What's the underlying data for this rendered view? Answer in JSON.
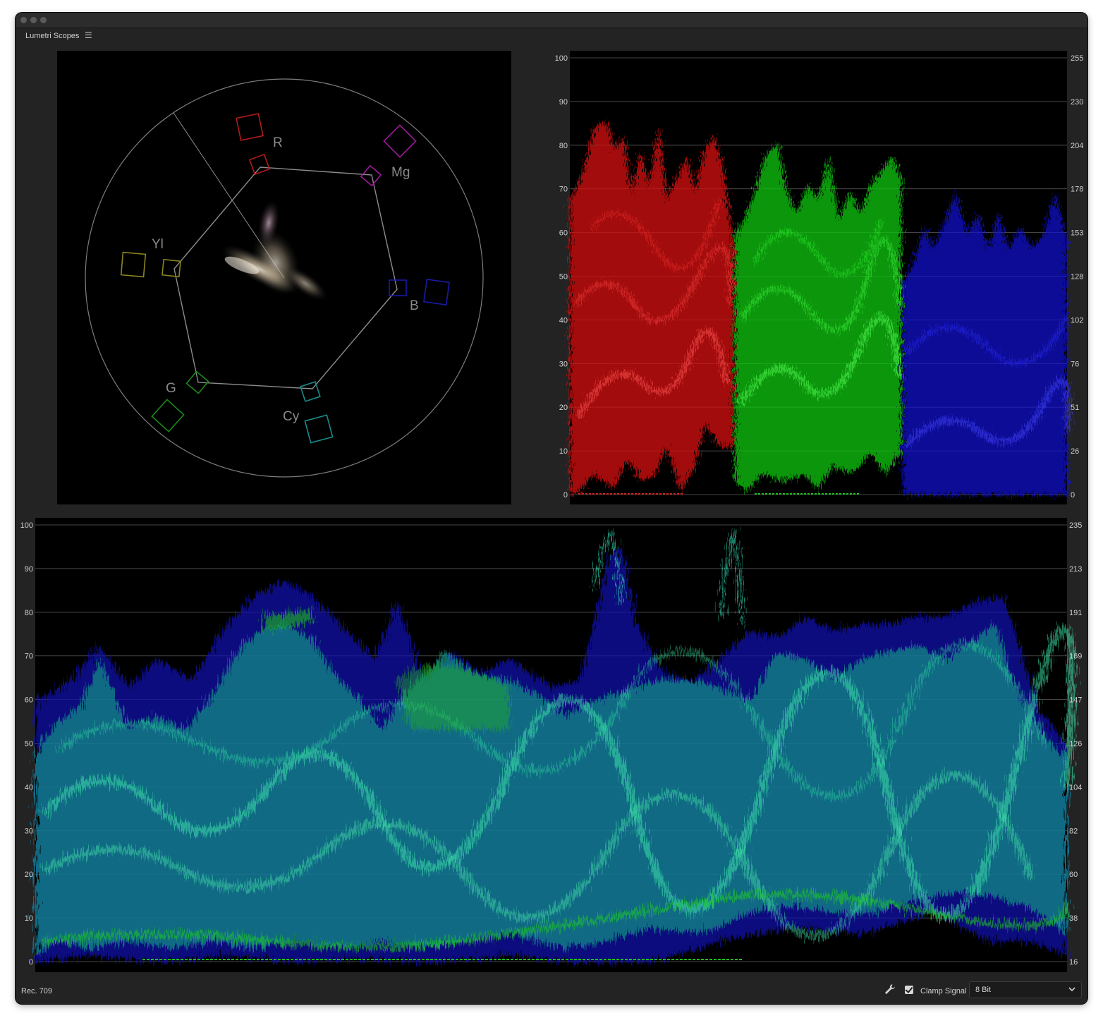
{
  "panel": {
    "title": "Lumetri Scopes",
    "menu_icon": "hamburger-menu-icon"
  },
  "vectorscope": {
    "targets": [
      "R",
      "Mg",
      "B",
      "Cy",
      "G",
      "Yl"
    ]
  },
  "parade": {
    "left_ticks": [
      "100",
      "90",
      "80",
      "70",
      "60",
      "50",
      "40",
      "30",
      "20",
      "10",
      "0"
    ],
    "right_ticks": [
      "255",
      "230",
      "204",
      "178",
      "153",
      "128",
      "102",
      "76",
      "51",
      "26",
      "0"
    ]
  },
  "waveform": {
    "left_ticks": [
      "100",
      "90",
      "80",
      "70",
      "60",
      "50",
      "40",
      "30",
      "20",
      "10",
      "0"
    ],
    "right_ticks": [
      "235",
      "213",
      "191",
      "169",
      "147",
      "126",
      "104",
      "82",
      "60",
      "38",
      "16"
    ]
  },
  "footer": {
    "color_space": "Rec. 709",
    "settings_icon": "wrench-icon",
    "clamp_signal_label": "Clamp Signal",
    "clamp_signal_checked": true,
    "bit_depth": "8 Bit",
    "dropdown_icon": "chevron-down-icon"
  },
  "colors": {
    "red": "#e01010",
    "green": "#18d018",
    "blue": "#1818d8",
    "luma": "#20c8a0",
    "graticule": "#8a8a8a"
  }
}
